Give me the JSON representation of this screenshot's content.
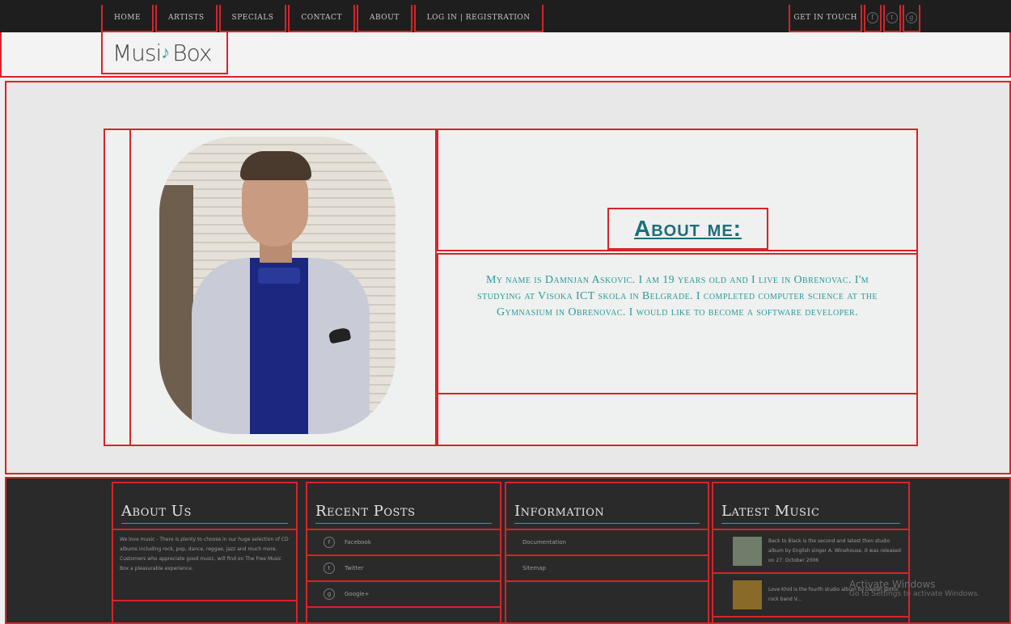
{
  "nav": {
    "left": [
      "HOME",
      "ARTISTS",
      "SPECIALS",
      "CONTACT",
      "ABOUT",
      "LOG IN | REGISTRATION"
    ],
    "get_in_touch": "GET IN TOUCH",
    "icons": [
      "facebook-icon",
      "twitter-icon",
      "google-plus-icon"
    ]
  },
  "logo": {
    "text_a": "Musi",
    "text_b": "Box",
    "note": "♪"
  },
  "about": {
    "title": "About me:",
    "text": "My name is Damnjan Askovic. I am 19 years old and I live in Obrenovac. I'm studying at Visoka ICT skola in Belgrade. I completed computer science at the Gymnasium in Obrenovac. I would like to become a software developer."
  },
  "footer": {
    "about_us": {
      "title": "About Us",
      "text": "We love music - There is plenty to choose in our huge selection of CD albums including rock, pop, dance, reggae, jazz and much more. Customers who appreciate good music, will find on The Free Music Box a pleasurable experience."
    },
    "recent_posts": {
      "title": "Recent Posts",
      "items": [
        {
          "icon": "f",
          "label": "Facebook"
        },
        {
          "icon": "t",
          "label": "Twitter"
        },
        {
          "icon": "g",
          "label": "Google+"
        }
      ]
    },
    "information": {
      "title": "Information",
      "items": [
        "Documentation",
        "Sitemap"
      ]
    },
    "latest_music": {
      "title": "Latest Music",
      "items": [
        "Back to Black is the second and latest then studio album by English singer A. Winehouse, it was released on 27. October 2006",
        "Love Khid is the fourth studio album by Danish gothic rock band V..."
      ]
    }
  },
  "watermark": {
    "title": "Activate Windows",
    "sub": "Go to Settings to activate Windows."
  }
}
